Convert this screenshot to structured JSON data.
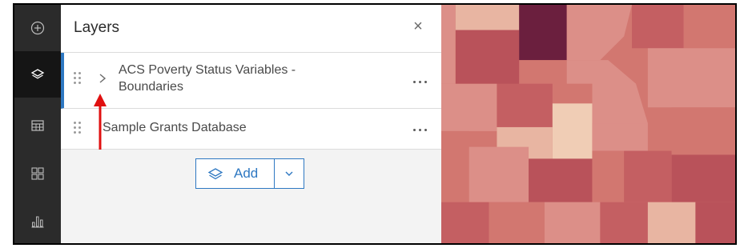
{
  "toolbar": {
    "items": [
      {
        "icon": "add-circle-icon",
        "active": false
      },
      {
        "icon": "layers-icon",
        "active": true
      },
      {
        "icon": "table-icon",
        "active": false
      },
      {
        "icon": "legend-icon",
        "active": false
      },
      {
        "icon": "chart-icon",
        "active": false
      }
    ]
  },
  "panel": {
    "title": "Layers",
    "close_glyph": "×",
    "layers": [
      {
        "label_line1": "ACS Poverty Status Variables -",
        "label_line2": "Boundaries",
        "selected": true,
        "expandable": true
      },
      {
        "label": "Sample Grants Database",
        "selected": false,
        "expandable": false
      }
    ],
    "add_button": {
      "label": "Add"
    }
  },
  "colors": {
    "accent": "#2e78c2",
    "toolbar_bg": "#2b2b2b",
    "annotation_arrow": "#e01010",
    "map_palette": [
      "#6b1f3e",
      "#b9525a",
      "#c45f62",
      "#d27770",
      "#dc8f88",
      "#e8b5a2",
      "#f0cdb5"
    ]
  }
}
